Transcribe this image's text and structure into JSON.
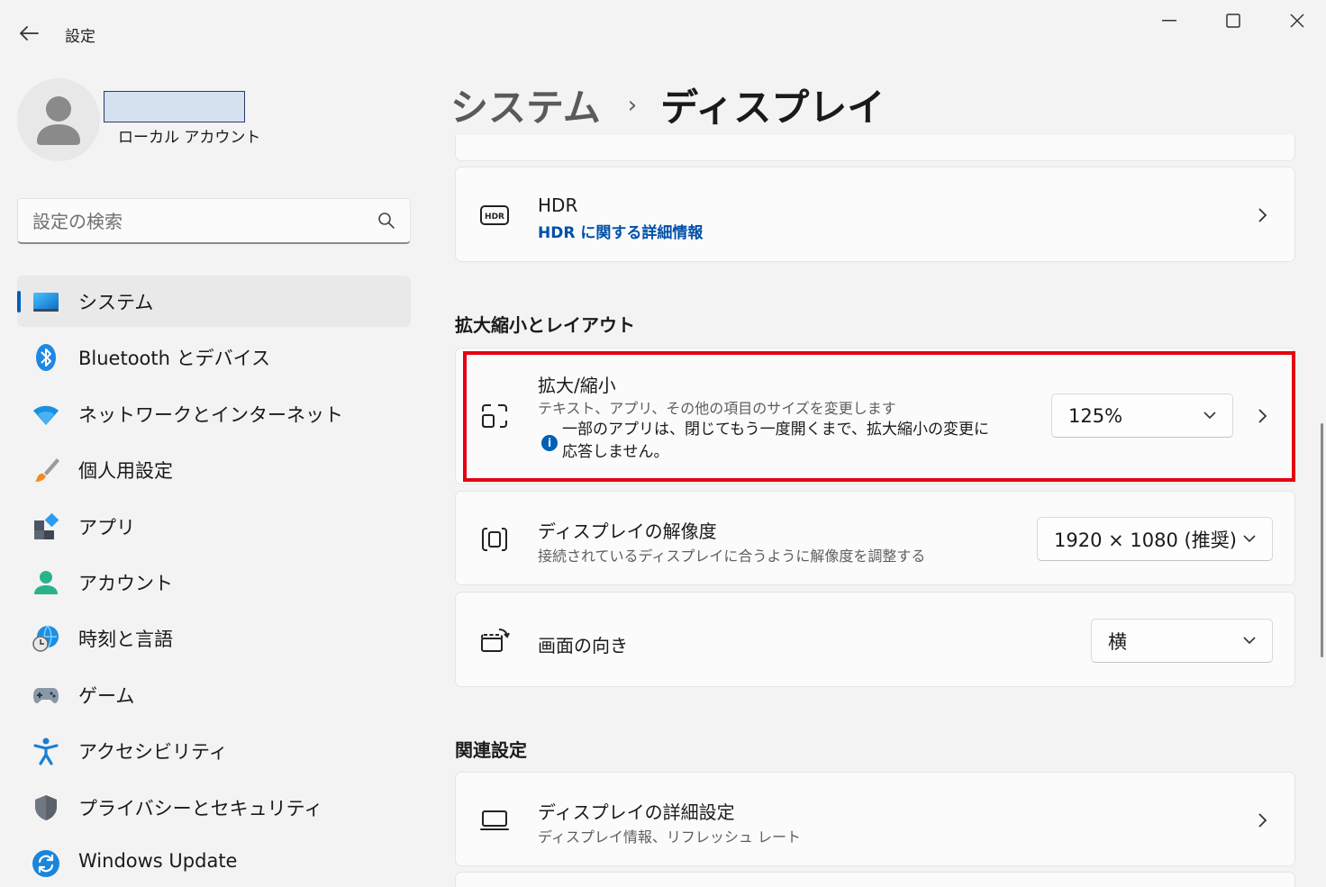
{
  "window": {
    "app_title": "設定"
  },
  "account": {
    "type": "ローカル アカウント"
  },
  "search": {
    "placeholder": "設定の検索"
  },
  "sidebar": {
    "items": [
      {
        "label": "システム",
        "icon": "system-icon",
        "active": true
      },
      {
        "label": "Bluetooth とデバイス",
        "icon": "bluetooth-icon"
      },
      {
        "label": "ネットワークとインターネット",
        "icon": "wifi-icon"
      },
      {
        "label": "個人用設定",
        "icon": "brush-icon"
      },
      {
        "label": "アプリ",
        "icon": "apps-icon"
      },
      {
        "label": "アカウント",
        "icon": "account-icon"
      },
      {
        "label": "時刻と言語",
        "icon": "time-language-icon"
      },
      {
        "label": "ゲーム",
        "icon": "gamepad-icon"
      },
      {
        "label": "アクセシビリティ",
        "icon": "accessibility-icon"
      },
      {
        "label": "プライバシーとセキュリティ",
        "icon": "shield-icon"
      },
      {
        "label": "Windows Update",
        "icon": "windows-update-icon"
      }
    ]
  },
  "breadcrumb": {
    "parent": "システム",
    "separator": "›",
    "current": "ディスプレイ"
  },
  "hdr": {
    "title": "HDR",
    "link": "HDR に関する詳細情報",
    "icon": "hdr-icon"
  },
  "scale_layout": {
    "section_title": "拡大縮小とレイアウト",
    "scale": {
      "title": "拡大/縮小",
      "subtitle": "テキスト、アプリ、その他の項目のサイズを変更します",
      "note": "一部のアプリは、閉じてもう一度開くまで、拡大縮小の変更に応答しません。",
      "value": "125%",
      "icon": "scale-icon"
    },
    "resolution": {
      "title": "ディスプレイの解像度",
      "subtitle": "接続されているディスプレイに合うように解像度を調整する",
      "value": "1920 × 1080 (推奨)",
      "icon": "resolution-icon"
    },
    "orientation": {
      "title": "画面の向き",
      "value": "横",
      "icon": "orientation-icon"
    }
  },
  "related": {
    "section_title": "関連設定",
    "advanced_display": {
      "title": "ディスプレイの詳細設定",
      "subtitle": "ディスプレイ情報、リフレッシュ レート",
      "icon": "monitor-icon"
    }
  },
  "colors": {
    "accent": "#005fb8",
    "highlight_border": "#e60012",
    "link": "#0050a8"
  }
}
